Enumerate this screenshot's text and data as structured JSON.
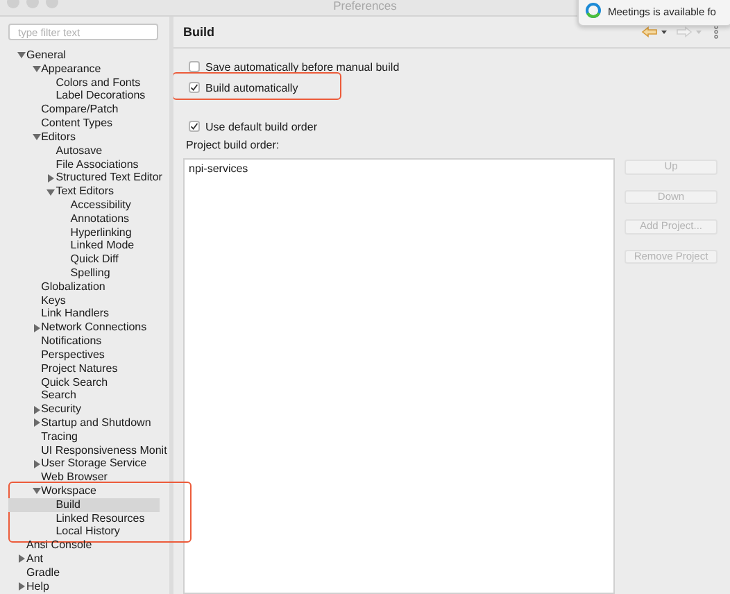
{
  "window": {
    "title": "Preferences"
  },
  "notification": {
    "text": "Meetings is available fo"
  },
  "sidebar": {
    "filter": {
      "placeholder": "type filter text"
    },
    "tree": [
      {
        "label": "General",
        "expanded": true,
        "selected": false,
        "children": [
          {
            "label": "Appearance",
            "expanded": true,
            "selected": false,
            "children": [
              {
                "label": "Colors and Fonts",
                "selected": false
              },
              {
                "label": "Label Decorations",
                "selected": false
              }
            ]
          },
          {
            "label": "Compare/Patch",
            "selected": false
          },
          {
            "label": "Content Types",
            "selected": false
          },
          {
            "label": "Editors",
            "expanded": true,
            "selected": false,
            "children": [
              {
                "label": "Autosave",
                "selected": false
              },
              {
                "label": "File Associations",
                "selected": false
              },
              {
                "label": "Structured Text Editor",
                "expanded": false,
                "selected": false
              },
              {
                "label": "Text Editors",
                "expanded": true,
                "selected": false,
                "children": [
                  {
                    "label": "Accessibility",
                    "selected": false
                  },
                  {
                    "label": "Annotations",
                    "selected": false
                  },
                  {
                    "label": "Hyperlinking",
                    "selected": false
                  },
                  {
                    "label": "Linked Mode",
                    "selected": false
                  },
                  {
                    "label": "Quick Diff",
                    "selected": false
                  },
                  {
                    "label": "Spelling",
                    "selected": false
                  }
                ]
              }
            ]
          },
          {
            "label": "Globalization",
            "selected": false
          },
          {
            "label": "Keys",
            "selected": false
          },
          {
            "label": "Link Handlers",
            "selected": false
          },
          {
            "label": "Network Connections",
            "expanded": false,
            "selected": false
          },
          {
            "label": "Notifications",
            "selected": false
          },
          {
            "label": "Perspectives",
            "selected": false
          },
          {
            "label": "Project Natures",
            "selected": false
          },
          {
            "label": "Quick Search",
            "selected": false
          },
          {
            "label": "Search",
            "selected": false
          },
          {
            "label": "Security",
            "expanded": false,
            "selected": false
          },
          {
            "label": "Startup and Shutdown",
            "expanded": false,
            "selected": false
          },
          {
            "label": "Tracing",
            "selected": false
          },
          {
            "label": "UI Responsiveness Monit",
            "selected": false
          },
          {
            "label": "User Storage Service",
            "expanded": false,
            "selected": false
          },
          {
            "label": "Web Browser",
            "selected": false
          },
          {
            "label": "Workspace",
            "expanded": true,
            "selected": false,
            "highlighted": true,
            "children": [
              {
                "label": "Build",
                "selected": true
              },
              {
                "label": "Linked Resources",
                "selected": false
              },
              {
                "label": "Local History",
                "selected": false
              }
            ]
          }
        ]
      },
      {
        "label": "Ansi Console",
        "selected": false
      },
      {
        "label": "Ant",
        "expanded": false,
        "selected": false
      },
      {
        "label": "Gradle",
        "selected": false
      },
      {
        "label": "Help",
        "expanded": false,
        "selected": false
      }
    ]
  },
  "page": {
    "title": "Build",
    "options": [
      {
        "label": "Save automatically before manual build",
        "checked": false,
        "highlighted": false
      },
      {
        "label": "Build automatically",
        "checked": true,
        "highlighted": true
      }
    ],
    "build_order": {
      "use_default": {
        "label": "Use default build order",
        "checked": true
      },
      "label": "Project build order:",
      "projects": [
        "npi-services"
      ],
      "buttons": [
        {
          "label": "Up",
          "disabled": true
        },
        {
          "label": "Down",
          "disabled": true
        },
        {
          "label": "Add Project...",
          "disabled": true
        },
        {
          "label": "Remove Project",
          "disabled": true
        }
      ]
    }
  }
}
